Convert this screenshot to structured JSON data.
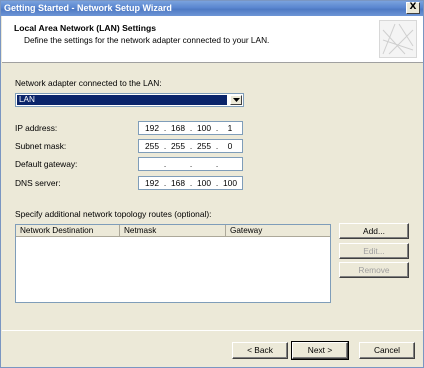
{
  "window": {
    "title": "Getting Started - Network Setup Wizard",
    "close_glyph": "X"
  },
  "header": {
    "title": "Local Area Network (LAN) Settings",
    "subtitle": "Define the settings for the network adapter connected to your LAN."
  },
  "adapter": {
    "label": "Network adapter connected to the LAN:",
    "selected": "LAN"
  },
  "fields": {
    "ip_label": "IP address:",
    "ip": [
      "192",
      "168",
      "100",
      "1"
    ],
    "mask_label": "Subnet mask:",
    "mask": [
      "255",
      "255",
      "255",
      "0"
    ],
    "gateway_label": "Default gateway:",
    "gateway": [
      "",
      "",
      "",
      ""
    ],
    "dns_label": "DNS server:",
    "dns": [
      "192",
      "168",
      "100",
      "100"
    ],
    "dot": "."
  },
  "routes": {
    "label": "Specify additional network topology routes (optional):",
    "columns": [
      "Network Destination",
      "Netmask",
      "Gateway"
    ],
    "add_label": "Add...",
    "edit_label": "Edit...",
    "remove_label": "Remove"
  },
  "footer": {
    "back_label": "< Back",
    "next_label": "Next >",
    "cancel_label": "Cancel"
  },
  "colors": {
    "title_bar": "#5a86cf",
    "selection": "#0a246a",
    "dialog_bg": "#ece9d8"
  }
}
